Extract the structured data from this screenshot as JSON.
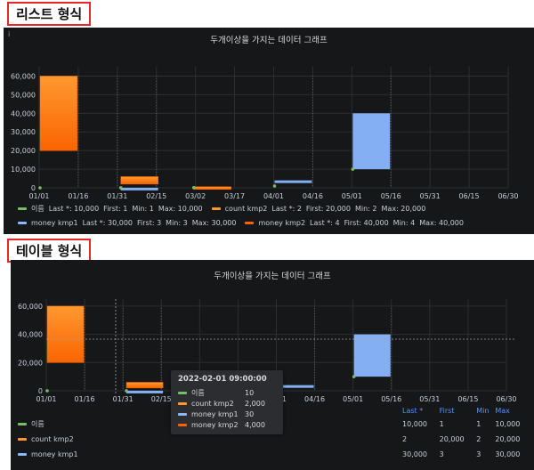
{
  "labels": {
    "list_section": "리스트 형식",
    "table_section": "테이블 형식"
  },
  "panels": {
    "info_glyph": "i",
    "title": "두개이상을 가지는 데이터 그래프"
  },
  "axis": {
    "y_ticks_top": [
      "60,000",
      "50,000",
      "40,000",
      "30,000",
      "20,000",
      "10,000",
      "0"
    ],
    "x_ticks_top": [
      "01/01",
      "01/16",
      "01/31",
      "02/15",
      "03/02",
      "03/17",
      "04/01",
      "04/16",
      "05/01",
      "05/16",
      "05/31",
      "06/15",
      "06/30"
    ],
    "y_ticks_bottom": [
      "60,000",
      "40,000",
      "20,000",
      "0"
    ],
    "x_ticks_bottom": [
      "01/01",
      "01/16",
      "01/31",
      "02/15",
      "03/02",
      "03/17",
      "04/01",
      "04/16",
      "05/01",
      "05/16",
      "05/31",
      "06/15",
      "06/30"
    ]
  },
  "legend_list": {
    "row1": [
      {
        "name": "이름",
        "color": "#73bf69",
        "stats": [
          "Last *: 10,000",
          "First: 1",
          "Min: 1",
          "Max: 10,000"
        ]
      },
      {
        "name": "count kmp2",
        "color": "#ff9830",
        "stats": [
          "Last *: 2",
          "First: 20,000",
          "Min: 2",
          "Max: 20,000"
        ]
      }
    ],
    "row2": [
      {
        "name": "money kmp1",
        "color": "#8ab8ff",
        "stats": [
          "Last *: 30,000",
          "First: 3",
          "Min: 3",
          "Max: 30,000"
        ]
      },
      {
        "name": "money kmp2",
        "color": "#fa6400",
        "stats": [
          "Last *: 4",
          "First: 40,000",
          "Min: 4",
          "Max: 40,000"
        ]
      }
    ]
  },
  "legend_table": {
    "headers": [
      "Last *",
      "First",
      "Min",
      "Max"
    ],
    "rows": [
      {
        "name": "이름",
        "color": "#73bf69",
        "values": [
          "10,000",
          "1",
          "1",
          "10,000"
        ]
      },
      {
        "name": "count kmp2",
        "color": "#ff9830",
        "values": [
          "2",
          "20,000",
          "2",
          "20,000"
        ]
      },
      {
        "name": "money kmp1",
        "color": "#8ab8ff",
        "values": [
          "30,000",
          "3",
          "3",
          "30,000"
        ]
      }
    ]
  },
  "tooltip": {
    "time": "2022-02-01 09:00:00",
    "rows": [
      {
        "name": "이름",
        "value": "10",
        "color": "#73bf69"
      },
      {
        "name": "count kmp2",
        "value": "2,000",
        "color": "#ff9830"
      },
      {
        "name": "money kmp1",
        "value": "30",
        "color": "#8ab8ff"
      },
      {
        "name": "money kmp2",
        "value": "4,000",
        "color": "#fa6400"
      }
    ]
  },
  "chart_data": [
    {
      "type": "bar",
      "title": "두개이상을 가지는 데이터 그래프",
      "x_ticks": [
        "01/01",
        "01/16",
        "01/31",
        "02/15",
        "03/02",
        "03/17",
        "04/01",
        "04/16",
        "05/01",
        "05/16",
        "05/31",
        "06/15",
        "06/30"
      ],
      "ylim": [
        0,
        65000
      ],
      "series": [
        {
          "name": "이름",
          "color": "#73bf69",
          "x": [
            "01/01",
            "02/01",
            "03/01",
            "04/01",
            "05/01"
          ],
          "values": [
            1,
            10,
            100,
            1000,
            10000
          ]
        },
        {
          "name": "count kmp2",
          "color": "#ff9830",
          "x": [
            "01/01",
            "02/01",
            "03/01"
          ],
          "ranges": [
            [
              20000,
              60000
            ],
            [
              2000,
              6000
            ],
            [
              200,
              600
            ]
          ]
        },
        {
          "name": "money kmp1",
          "color": "#8ab8ff",
          "x": [
            "02/01",
            "04/01",
            "05/01"
          ],
          "ranges": [
            [
              30,
              50
            ],
            [
              3000,
              4000
            ],
            [
              10000,
              40000
            ]
          ]
        },
        {
          "name": "money kmp2",
          "color": "#fa6400",
          "x": [
            "01/01",
            "02/01",
            "03/01"
          ],
          "ranges": [
            [
              20000,
              40000
            ],
            [
              2000,
              4000
            ],
            [
              200,
              400
            ]
          ]
        }
      ],
      "grid": true
    }
  ]
}
